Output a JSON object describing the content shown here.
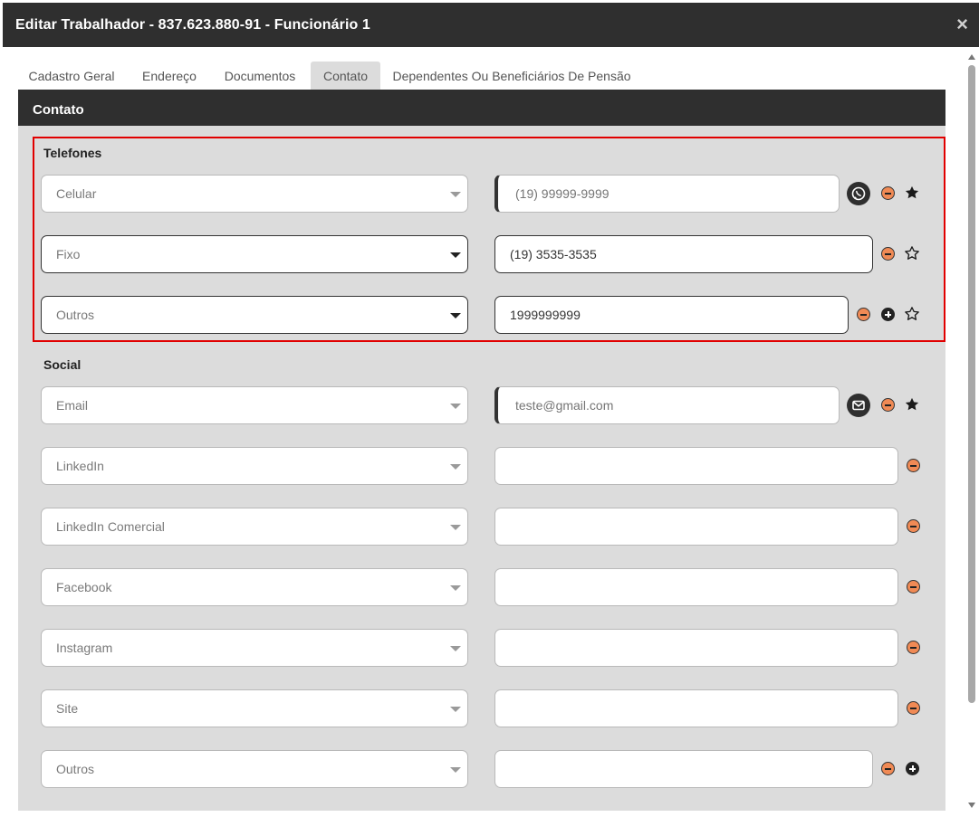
{
  "dialog": {
    "title": "Editar Trabalhador - 837.623.880-91 - Funcionário 1",
    "close_glyph": "×"
  },
  "tabs": [
    {
      "label": "Cadastro Geral"
    },
    {
      "label": "Endereço"
    },
    {
      "label": "Documentos"
    },
    {
      "label": "Contato",
      "active": true
    },
    {
      "label": "Dependentes Ou Beneficiários De Pensão"
    }
  ],
  "panel": {
    "title": "Contato"
  },
  "telefones": {
    "title": "Telefones",
    "rows": [
      {
        "type": "Celular",
        "value": "",
        "placeholder": "(19) 99999-9999"
      },
      {
        "type": "Fixo",
        "value": "(19) 3535-3535",
        "placeholder": ""
      },
      {
        "type": "Outros",
        "value": "1999999999",
        "placeholder": ""
      }
    ]
  },
  "social": {
    "title": "Social",
    "rows": [
      {
        "type": "Email",
        "value": "",
        "placeholder": "teste@gmail.com"
      },
      {
        "type": "LinkedIn",
        "value": ""
      },
      {
        "type": "LinkedIn Comercial",
        "value": ""
      },
      {
        "type": "Facebook",
        "value": ""
      },
      {
        "type": "Instagram",
        "value": ""
      },
      {
        "type": "Site",
        "value": ""
      },
      {
        "type": "Outros",
        "value": ""
      }
    ]
  },
  "colors": {
    "header": "#2f2f2f",
    "panel": "#dcdcdc",
    "highlight": "#e10000",
    "remove": "#f08a55"
  },
  "icons": {
    "whatsapp": "whatsapp-icon",
    "email": "mail-icon",
    "remove": "minus-circle-icon",
    "add": "plus-circle-icon",
    "favorite": "star-icon"
  }
}
